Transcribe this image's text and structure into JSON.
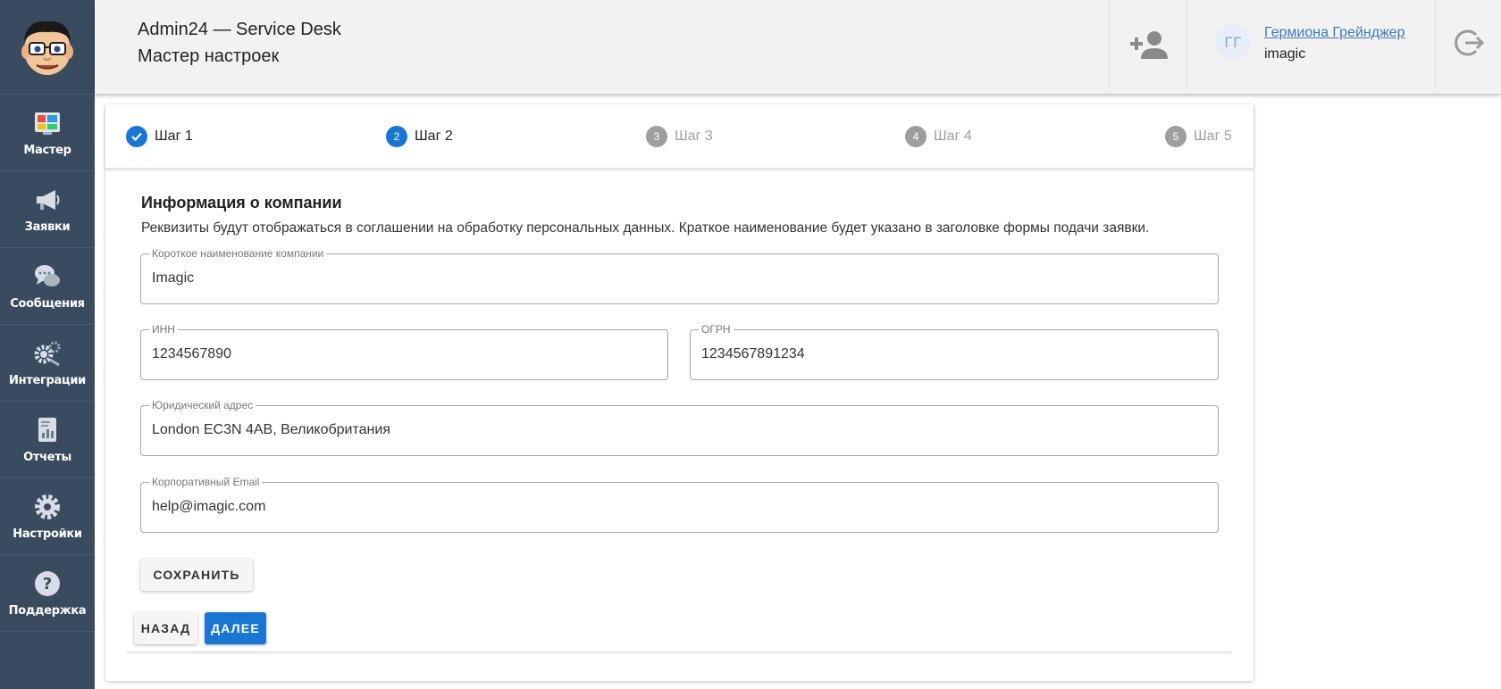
{
  "header": {
    "title": "Admin24 — Service Desk",
    "subtitle": "Мастер настроек",
    "user_initials": "ГГ",
    "user_name": "Гермиона Грейнджер",
    "user_org": "imagic"
  },
  "sidebar": {
    "items": [
      {
        "label": "Мастер",
        "icon": "dashboard-icon"
      },
      {
        "label": "Заявки",
        "icon": "megaphone-icon"
      },
      {
        "label": "Сообщения",
        "icon": "chat-bubbles-icon"
      },
      {
        "label": "Интеграции",
        "icon": "gears-icon"
      },
      {
        "label": "Отчеты",
        "icon": "report-icon"
      },
      {
        "label": "Настройки",
        "icon": "settings-gear-icon"
      },
      {
        "label": "Поддержка",
        "icon": "help-icon"
      }
    ]
  },
  "stepper": {
    "steps": [
      {
        "label": "Шаг 1",
        "number": "1",
        "state": "done"
      },
      {
        "label": "Шаг 2",
        "number": "2",
        "state": "active"
      },
      {
        "label": "Шаг 3",
        "number": "3",
        "state": "future"
      },
      {
        "label": "Шаг 4",
        "number": "4",
        "state": "future"
      },
      {
        "label": "Шаг 5",
        "number": "5",
        "state": "future"
      }
    ]
  },
  "form": {
    "title": "Информация о компании",
    "description": "Реквизиты будут отображаться в соглашении на обработку персональных данных. Краткое наименование будет указано в заголовке формы подачи заявки.",
    "company_name": {
      "label": "Короткое наименование компании",
      "value": "Imagic"
    },
    "inn": {
      "label": "ИНН",
      "value": "1234567890"
    },
    "ogrn": {
      "label": "ОГРН",
      "value": "1234567891234"
    },
    "address": {
      "label": "Юридический адрес",
      "value": "London EC3N 4AB, Великобритания"
    },
    "email": {
      "label": "Корпоративный Email",
      "value": "help@imagic.com"
    }
  },
  "buttons": {
    "save": "СОХРАНИТЬ",
    "back": "НАЗАД",
    "next": "ДАЛЕЕ"
  },
  "colors": {
    "sidebar_bg": "#3a4b60",
    "accent": "#1976d2",
    "header_bg": "#f2f2f2"
  }
}
